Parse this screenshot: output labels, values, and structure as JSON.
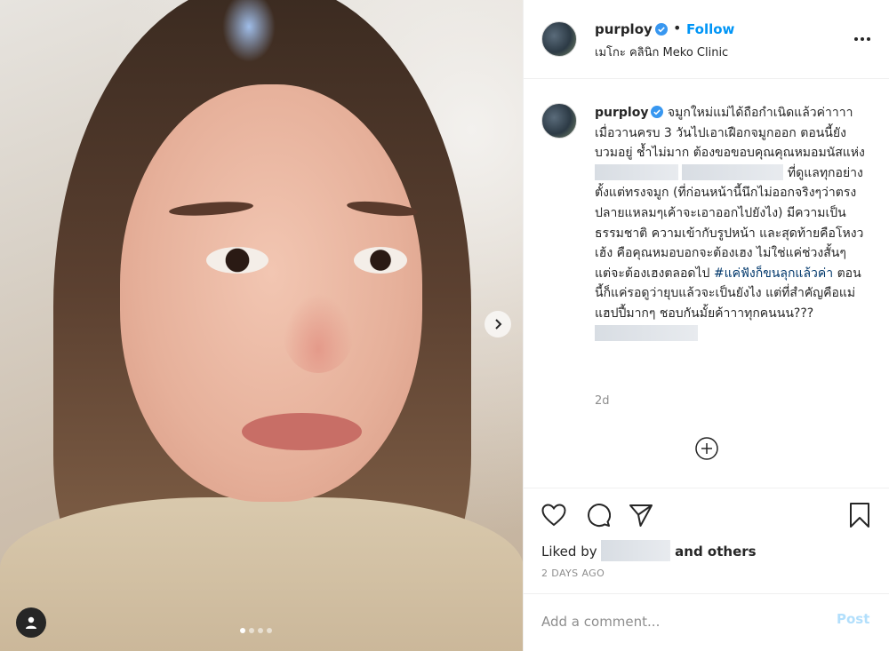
{
  "post": {
    "carousel_dots": 4,
    "carousel_active_index": 0
  },
  "header": {
    "username": "purploy",
    "bullet": "•",
    "follow_label": "Follow",
    "location": "เมโกะ คลินิก Meko Clinic"
  },
  "caption": {
    "username": "purploy",
    "part1": "จมูกใหม่แม่ได้ถือกำเนิดแล้วค่าาาา เมื่อวานครบ 3 วันไปเอาเฝือกจมูกออก ตอนนี้ยังบวมอยู่ ช้ำไม่มาก ต้องขอขอบคุณคุณหมอมนัสแห่ง",
    "part2": "ที่ดูแลทุกอย่างตั้งแต่ทรงจมูก (ที่ก่อนหน้านี้นึกไม่ออกจริงๆว่าตรงปลายแหลมๆเค้าจะเอาออกไปยังไง) มีความเป็นธรรมชาติ ความเข้ากับรูปหน้า และสุดท้ายคือโหงวเฮ้ง คือคุณหมอบอกจะต้องเฮง ไม่ใช่แค่ช่วงสั้นๆ แต่จะต้องเฮงตลอดไป ",
    "hashtag": "#แค่ฟังก็ขนลุกแล้วค่า",
    "part3": " ตอนนี้ก็แค่รอดูว่ายุบแล้วจะเป็นยังไง แต่ที่สำคัญคือแม่แฮปปี้มากๆ ชอบกันมั้ยค้าาาทุกคนนน???",
    "time_ago": "2d"
  },
  "actions": {
    "liked_by_prefix": "Liked by",
    "liked_by_suffix": "and others",
    "post_date": "2 DAYS AGO"
  },
  "comment": {
    "placeholder": "Add a comment...",
    "post_label": "Post"
  },
  "colors": {
    "accent": "#0095f6",
    "post_disabled": "#b2dffc",
    "verified": "#3897f0",
    "hashtag": "#00376b"
  },
  "icons": {
    "verified": "verified-badge-icon",
    "more": "more-options-icon",
    "carousel_next": "chevron-right-icon",
    "tag_users": "user-icon",
    "load_more": "plus-circle-icon",
    "like": "heart-icon",
    "comment": "comment-bubble-icon",
    "share": "paper-plane-icon",
    "save": "bookmark-icon"
  }
}
